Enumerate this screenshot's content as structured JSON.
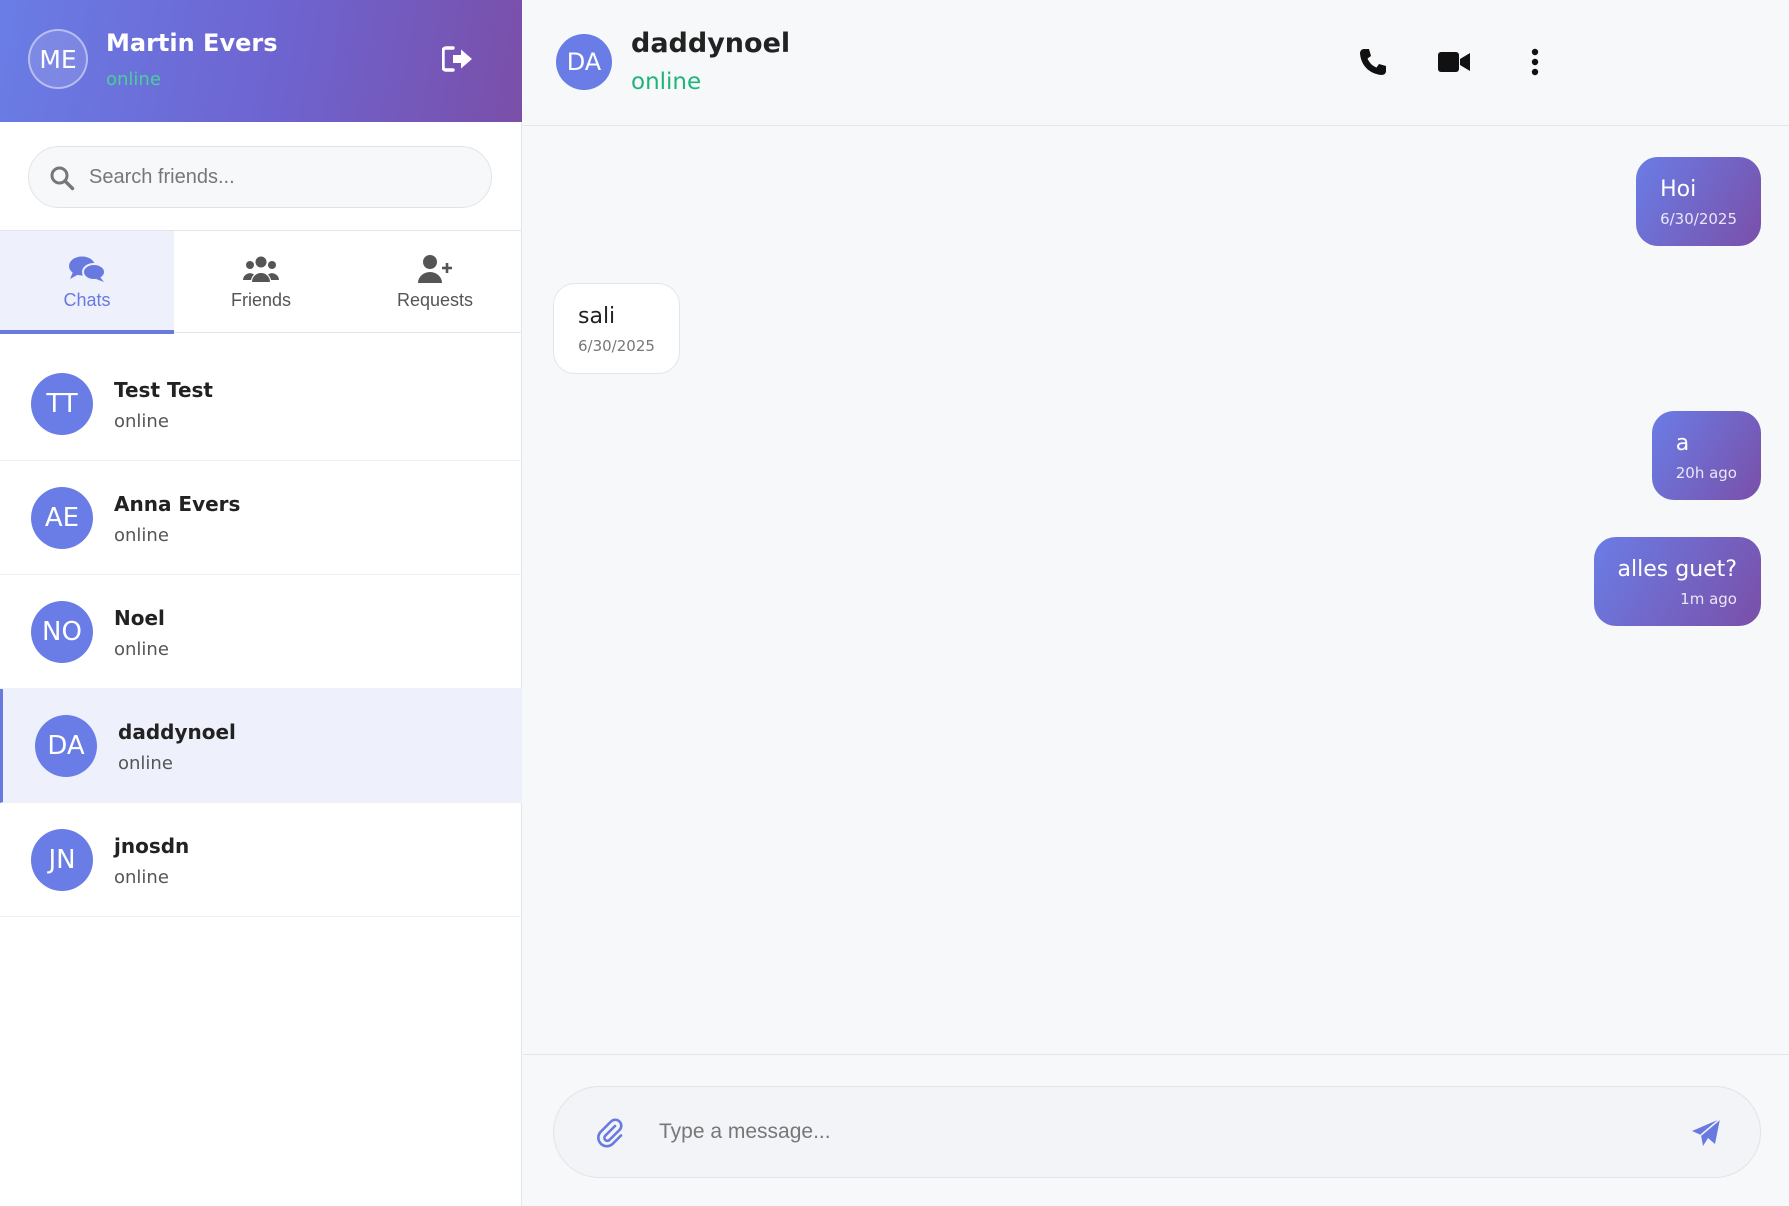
{
  "profile": {
    "initials": "ME",
    "name": "Martin Evers",
    "status": "online",
    "logout_icon": "logout-icon"
  },
  "search": {
    "placeholder": "Search friends...",
    "icon": "search-icon"
  },
  "tabs": [
    {
      "label": "Chats",
      "icon": "chats-icon",
      "active": true
    },
    {
      "label": "Friends",
      "icon": "friends-icon",
      "active": false
    },
    {
      "label": "Requests",
      "icon": "add-user-icon",
      "active": false
    }
  ],
  "chats": [
    {
      "initials": "TT",
      "name": "Test Test",
      "status": "online"
    },
    {
      "initials": "AE",
      "name": "Anna Evers",
      "status": "online"
    },
    {
      "initials": "NO",
      "name": "Noel",
      "status": "online"
    },
    {
      "initials": "DA",
      "name": "daddynoel",
      "status": "online",
      "active": true
    },
    {
      "initials": "JN",
      "name": "jnosdn",
      "status": "online"
    }
  ],
  "conversation": {
    "initials": "DA",
    "name": "daddynoel",
    "status": "online",
    "actions": [
      "phone-icon",
      "video-icon",
      "more-vertical-icon"
    ]
  },
  "messages": [
    {
      "direction": "out",
      "text": "Hoi",
      "time": "6/30/2025"
    },
    {
      "direction": "in",
      "text": "sali",
      "time": "6/30/2025"
    },
    {
      "direction": "out",
      "text": "a",
      "time": "20h ago"
    },
    {
      "direction": "out",
      "text": "alles guet?",
      "time": "1m ago"
    }
  ],
  "composer": {
    "placeholder": "Type a message...",
    "attach_icon": "paperclip-icon",
    "send_icon": "send-icon"
  },
  "colors": {
    "accent": "#6879e0",
    "gradient_start": "#6a7de6",
    "gradient_end": "#7a4fa8",
    "online_green": "#1fb57a"
  }
}
